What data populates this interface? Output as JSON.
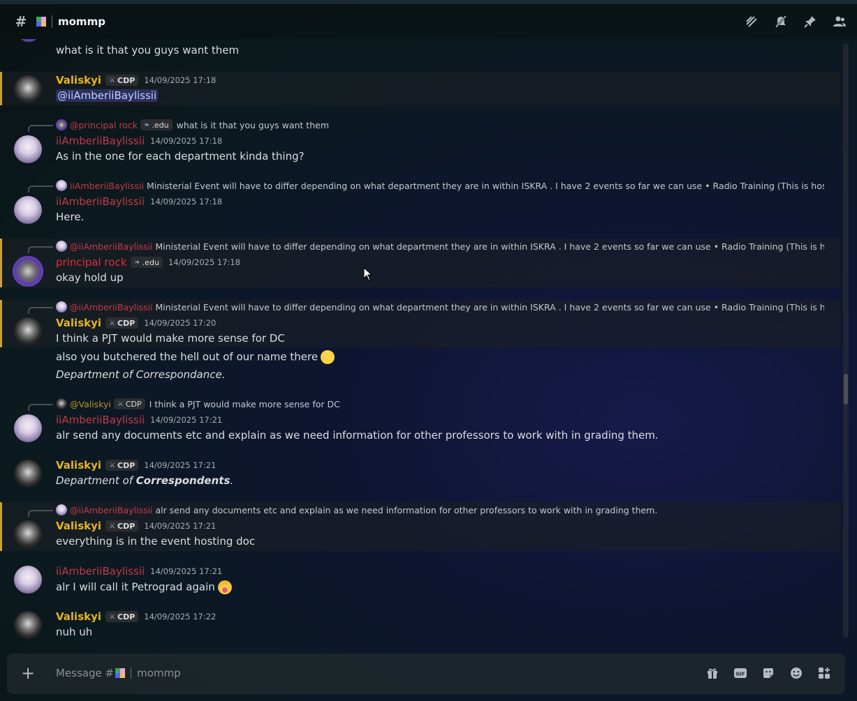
{
  "channel": {
    "name": "mommp"
  },
  "composer": {
    "placeholder_prefix": "Message #",
    "placeholder_channel": "mommp"
  },
  "tags": {
    "cdp": "CDP",
    "edu": ".edu"
  },
  "top_fragment": "what is it that you guys want them",
  "messages": [
    {
      "author": "Valiskyi",
      "time": "14/09/2025 17:18",
      "mention": "@iiAmberiiBaylissii"
    },
    {
      "reply_name": "@principal rock",
      "reply_text": "what is it that you guys want them",
      "author": "iiAmberiiBaylissii",
      "time": "14/09/2025 17:18",
      "text": "As in the one for each department kinda thing?"
    },
    {
      "reply_name": "iiAmberiiBaylissii",
      "reply_text": "Ministerial Event will have to differ depending on what department they are in  within ISKRA . I have 2 events so far we can use   • Radio Training (This is hosted at ...",
      "author": "iiAmberiiBaylissii",
      "time": "14/09/2025 17:18",
      "text": "Here."
    },
    {
      "reply_name": "@iiAmberiiBaylissii",
      "reply_text": "Ministerial Event will have to differ depending on what department they are in  within ISKRA . I have 2 events so far we can use   • Radio Training (This is hosted ...",
      "author": "principal rock",
      "time": "14/09/2025 17:18",
      "text": "okay hold up"
    },
    {
      "reply_name": "@iiAmberiiBaylissii",
      "reply_text": "Ministerial Event will have to differ depending on what department they are in  within ISKRA . I have 2 events so far we can use   • Radio Training (This is hosted ...",
      "author": "Valiskyi",
      "time": "14/09/2025 17:20",
      "text": "I think a PJT would make more sense for DC",
      "text2": "also you butchered the hell out of our name there",
      "text3": "Department of Correspondance."
    },
    {
      "reply_name": "@Valiskyi",
      "reply_text": "I think a PJT would make more sense for DC",
      "author": "iiAmberiiBaylissii",
      "time": "14/09/2025 17:21",
      "text": "alr send any documents etc and explain as we need information for other professors to work with in grading them."
    },
    {
      "author": "Valiskyi",
      "time": "14/09/2025 17:21",
      "text_prefix": "Department of ",
      "text_bold": "Correspondents",
      "text_suffix": "."
    },
    {
      "reply_name": "@iiAmberiiBaylissii",
      "reply_text": "alr send any documents etc and explain as we need information for other professors to work with in grading them.",
      "author": "Valiskyi",
      "time": "14/09/2025 17:21",
      "text": "everything is in the event hosting doc"
    },
    {
      "author": "iiAmberiiBaylissii",
      "time": "14/09/2025 17:21",
      "text": "alr I will call it Petrograd again"
    },
    {
      "author": "Valiskyi",
      "time": "14/09/2025 17:22",
      "text": "nuh uh"
    }
  ]
}
